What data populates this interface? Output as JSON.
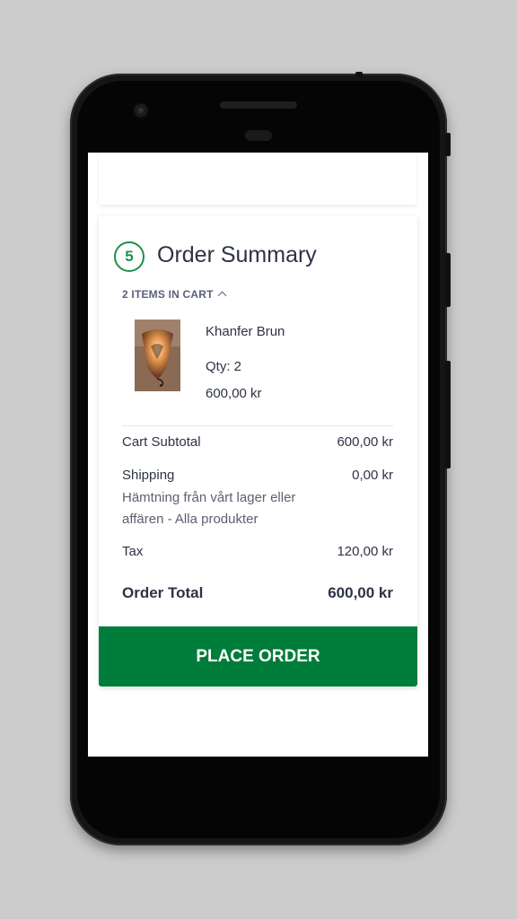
{
  "checkout": {
    "step_number": "5",
    "title": "Order Summary",
    "items_toggle": "2 ITEMS IN CART",
    "toggle_icon": "chevron-up-icon",
    "product": {
      "name": "Khanfer Brun",
      "qty": "Qty: 2",
      "price": "600,00 kr"
    },
    "totals": {
      "subtotal_label": "Cart Subtotal",
      "subtotal_value": "600,00 kr",
      "shipping_label": "Shipping",
      "shipping_value": "0,00 kr",
      "shipping_method": "Hämtning från vårt lager eller affären - Alla produkter",
      "tax_label": "Tax",
      "tax_value": "120,00 kr",
      "total_label": "Order Total",
      "total_value": "600,00 kr"
    },
    "place_order_label": "PLACE ORDER"
  },
  "colors": {
    "accent": "#017d3b",
    "badge": "#1e8f4a",
    "text": "#2d3345",
    "background": "#cccccc"
  }
}
